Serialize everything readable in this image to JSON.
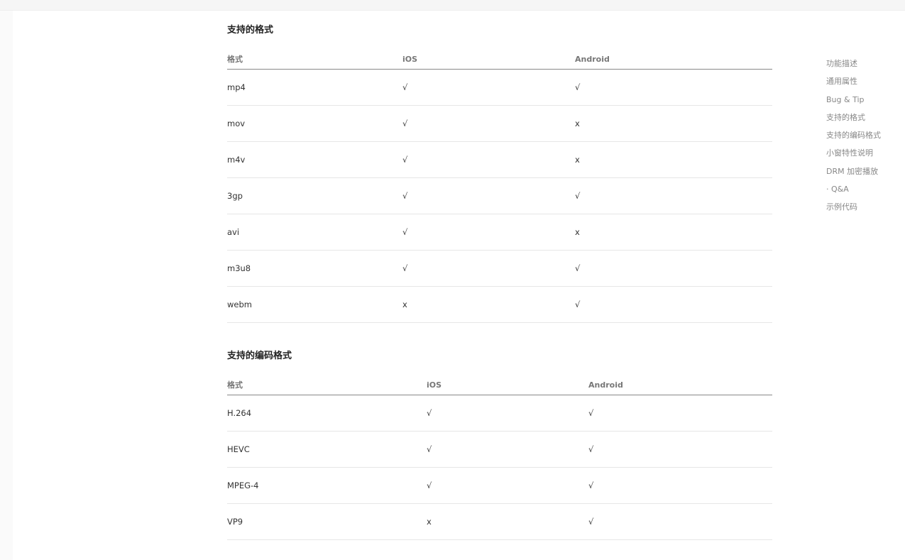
{
  "formats_section": {
    "title": "支持的格式",
    "headers": [
      "格式",
      "iOS",
      "Android"
    ],
    "rows": [
      [
        "mp4",
        "√",
        "√"
      ],
      [
        "mov",
        "√",
        "x"
      ],
      [
        "m4v",
        "√",
        "x"
      ],
      [
        "3gp",
        "√",
        "√"
      ],
      [
        "avi",
        "√",
        "x"
      ],
      [
        "m3u8",
        "√",
        "√"
      ],
      [
        "webm",
        "x",
        "√"
      ]
    ]
  },
  "codecs_section": {
    "title": "支持的编码格式",
    "headers": [
      "格式",
      "iOS",
      "Android"
    ],
    "rows": [
      [
        "H.264",
        "√",
        "√"
      ],
      [
        "HEVC",
        "√",
        "√"
      ],
      [
        "MPEG-4",
        "√",
        "√"
      ],
      [
        "VP9",
        "x",
        "√"
      ]
    ]
  },
  "toc": {
    "items": [
      "功能描述",
      "通用属性",
      "Bug & Tip",
      "支持的格式",
      "支持的编码格式",
      "小窗特性说明",
      "DRM 加密播放",
      "· Q&A",
      "示例代码"
    ]
  }
}
